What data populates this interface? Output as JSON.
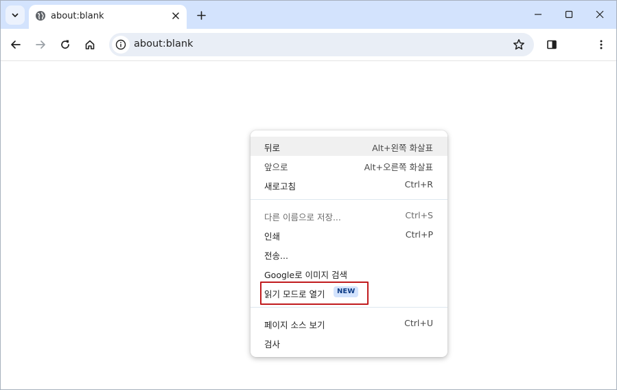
{
  "tab": {
    "title": "about:blank",
    "favicon": "globe-icon",
    "close_icon": "close-icon"
  },
  "tabstrip": {
    "search_icon": "chevron-down-icon",
    "new_tab_icon": "plus-icon"
  },
  "window_controls": [
    "minimize-icon",
    "maximize-icon",
    "close-icon"
  ],
  "toolbar": {
    "back_icon": "arrow-left-icon",
    "forward_icon": "arrow-right-icon",
    "reload_icon": "reload-icon",
    "home_icon": "home-icon",
    "side_panel_icon": "side-panel-icon",
    "menu_icon": "kebab-menu-icon"
  },
  "omnibox": {
    "url": "about:blank",
    "info_icon": "info-icon",
    "bookmark_icon": "star-icon"
  },
  "context_menu": {
    "items": [
      {
        "label": "뒤로",
        "shortcut": "Alt+왼쪽 화살표"
      },
      {
        "label": "앞으로",
        "shortcut": "Alt+오른쪽 화살표"
      },
      {
        "label": "새로고침",
        "shortcut": "Ctrl+R"
      },
      {
        "label": "다른 이름으로 저장...",
        "shortcut": "Ctrl+S"
      },
      {
        "label": "인쇄",
        "shortcut": "Ctrl+P"
      },
      {
        "label": "전송...",
        "shortcut": ""
      },
      {
        "label": "Google로 이미지 검색",
        "shortcut": ""
      },
      {
        "label": "읽기 모드로 열기",
        "shortcut": "",
        "badge": "NEW"
      },
      {
        "label": "페이지 소스 보기",
        "shortcut": "Ctrl+U"
      },
      {
        "label": "검사",
        "shortcut": ""
      }
    ],
    "highlight_color": "#c0191c",
    "badge_color": "#d3e3fd"
  }
}
